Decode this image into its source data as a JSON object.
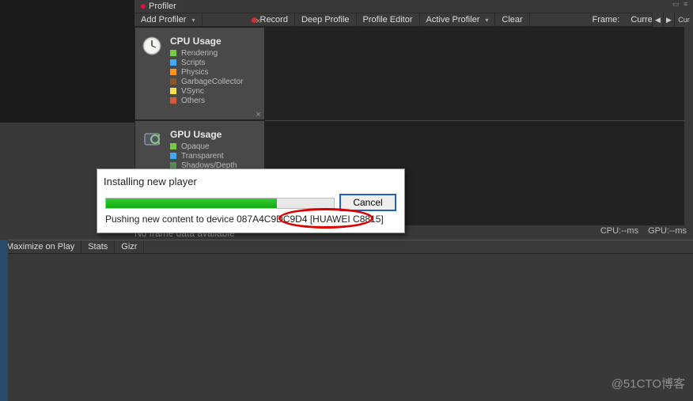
{
  "tab": {
    "title": "Profiler"
  },
  "toolbar": {
    "add_profiler": "Add Profiler",
    "record": "Record",
    "deep_profile": "Deep Profile",
    "profile_editor": "Profile Editor",
    "active_profiler": "Active Profiler",
    "clear": "Clear",
    "frame_label": "Frame:",
    "frame_value": "Current",
    "cur": "Cur"
  },
  "cpu": {
    "title": "CPU Usage",
    "items": [
      {
        "label": "Rendering",
        "color": "#7ac943"
      },
      {
        "label": "Scripts",
        "color": "#3fa9f5"
      },
      {
        "label": "Physics",
        "color": "#ff931e"
      },
      {
        "label": "GarbageCollector",
        "color": "#8b572a"
      },
      {
        "label": "VSync",
        "color": "#f7e04b"
      },
      {
        "label": "Others",
        "color": "#d85a3a"
      }
    ]
  },
  "gpu": {
    "title": "GPU Usage",
    "items": [
      {
        "label": "Opaque",
        "color": "#7ac943"
      },
      {
        "label": "Transparent",
        "color": "#3fa9f5"
      },
      {
        "label": "Shadows/Depth",
        "color": "#5a8a5a"
      }
    ]
  },
  "status": {
    "no_frame": "No frame data available",
    "cpu": "CPU:--ms",
    "gpu": "GPU:--ms"
  },
  "bottom_bar": {
    "maximize": "Maximize on Play",
    "stats": "Stats",
    "gizmos": "Gizr"
  },
  "dialog": {
    "title": "Installing new player",
    "cancel": "Cancel",
    "message": "Pushing new content to device 087A4C9DC9D4 [HUAWEI C8815]"
  },
  "watermark": "@51CTO博客"
}
